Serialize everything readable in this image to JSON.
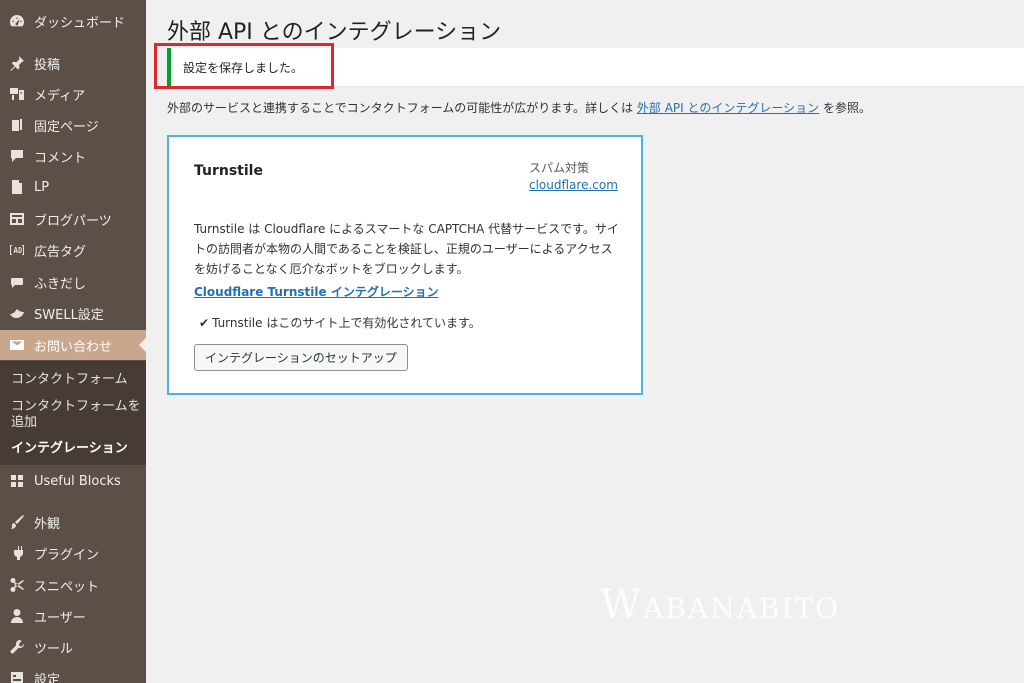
{
  "sidebar": {
    "items": [
      {
        "label": "ダッシュボード",
        "icon": "dashboard-icon"
      },
      {
        "label": "投稿",
        "icon": "pin-icon"
      },
      {
        "label": "メディア",
        "icon": "media-icon"
      },
      {
        "label": "固定ページ",
        "icon": "page-icon"
      },
      {
        "label": "コメント",
        "icon": "comment-icon"
      },
      {
        "label": "LP",
        "icon": "document-icon"
      },
      {
        "label": "ブログパーツ",
        "icon": "layout-icon"
      },
      {
        "label": "広告タグ",
        "icon": "ad-icon"
      },
      {
        "label": "ふきだし",
        "icon": "speech-bubble-icon"
      },
      {
        "label": "SWELL設定",
        "icon": "bird-icon"
      },
      {
        "label": "お問い合わせ",
        "icon": "envelope-icon"
      },
      {
        "label": "Useful Blocks",
        "icon": "blocks-icon"
      },
      {
        "label": "外観",
        "icon": "brush-icon"
      },
      {
        "label": "プラグイン",
        "icon": "plugin-icon"
      },
      {
        "label": "スニペット",
        "icon": "scissors-icon"
      },
      {
        "label": "ユーザー",
        "icon": "user-icon"
      },
      {
        "label": "ツール",
        "icon": "wrench-icon"
      },
      {
        "label": "設定",
        "icon": "settings-icon"
      }
    ],
    "active_item": "お問い合わせ",
    "submenu": {
      "items": [
        "コンタクトフォーム",
        "コンタクトフォームを追加",
        "インテグレーション"
      ],
      "current": "インテグレーション"
    }
  },
  "main": {
    "title": "外部 API とのインテグレーション",
    "notice": "設定を保存しました。",
    "description": {
      "before": "外部のサービスと連携することでコンタクトフォームの可能性が広がります。詳しくは ",
      "link": "外部 API とのインテグレーション",
      "after": " を参照。"
    },
    "card": {
      "title": "Turnstile",
      "category": "スパム対策",
      "domain": "cloudflare.com",
      "description": "Turnstile は Cloudflare によるスマートな CAPTCHA 代替サービスです。サイトの訪問者が本物の人間であることを検証し、正規のユーザーによるアクセスを妨げることなく厄介なボットをブロックします。",
      "integration_link": "Cloudflare Turnstile インテグレーション",
      "status": "Turnstile はこのサイト上で有効化されています。",
      "setup_button": "インテグレーションのセットアップ"
    }
  },
  "watermark": "Wabanabito",
  "colors": {
    "sidebar_bg": "#5b4f47",
    "sidebar_active": "#c9a78c",
    "submenu_bg": "#463c35",
    "link": "#2271b1",
    "notice_success": "#00a32a",
    "card_border": "#4eb3e6",
    "highlight": "#e0262e"
  }
}
